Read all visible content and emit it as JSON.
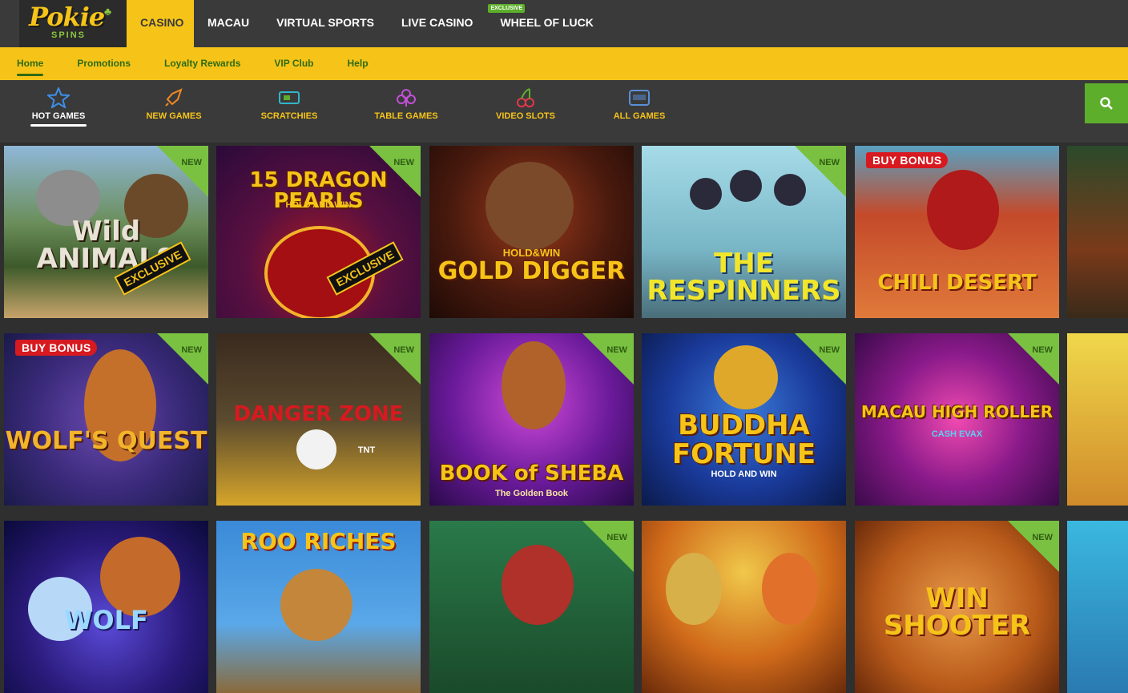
{
  "brand": {
    "name": "Pokie",
    "sub": "SPINS"
  },
  "top_nav": [
    {
      "label": "CASINO",
      "active": true
    },
    {
      "label": "MACAU"
    },
    {
      "label": "VIRTUAL SPORTS"
    },
    {
      "label": "LIVE CASINO"
    },
    {
      "label": "WHEEL OF LUCK",
      "badge": "EXCLUSIVE"
    }
  ],
  "sub_nav": [
    "Home",
    "Promotions",
    "Loyalty Rewards",
    "VIP Club",
    "Help"
  ],
  "categories": [
    {
      "label": "HOT GAMES",
      "icon": "star-icon",
      "active": true
    },
    {
      "label": "NEW GAMES",
      "icon": "rocket-icon"
    },
    {
      "label": "SCRATCHIES",
      "icon": "ticket-icon"
    },
    {
      "label": "TABLE GAMES",
      "icon": "club-icon"
    },
    {
      "label": "VIDEO SLOTS",
      "icon": "cherry-icon"
    },
    {
      "label": "ALL GAMES",
      "icon": "slot-machine-icon"
    }
  ],
  "badges": {
    "new": "NEW",
    "buy_bonus": "BUY BONUS",
    "exclusive": "EXCLUSIVE"
  },
  "games": [
    {
      "row": 0,
      "title": "Wild ANIMALS",
      "new": true,
      "exclusive": true
    },
    {
      "row": 0,
      "title": "15 DRAGON PEARLS",
      "sub": "HOLD AND WIN",
      "new": true,
      "exclusive": true
    },
    {
      "row": 0,
      "title": "GOLD DIGGER",
      "sub": "HOLD&WIN"
    },
    {
      "row": 0,
      "title": "THE RESPINNERS",
      "new": true
    },
    {
      "row": 0,
      "title": "CHILI DESERT",
      "buy_bonus": true
    },
    {
      "row": 1,
      "title": "WOLF'S QUEST",
      "new": true,
      "buy_bonus": true
    },
    {
      "row": 1,
      "title": "DANGER ZONE",
      "sub": "TNT",
      "new": true
    },
    {
      "row": 1,
      "title": "BOOK of SHEBA",
      "sub": "The Golden Book",
      "new": true
    },
    {
      "row": 1,
      "title": "BUDDHA FORTUNE",
      "sub": "HOLD AND WIN",
      "new": true
    },
    {
      "row": 1,
      "title": "MACAU HIGH ROLLER",
      "sub": "CASH EVAX",
      "new": true
    },
    {
      "row": 2,
      "title": "WOLF"
    },
    {
      "row": 2,
      "title": "ROO RICHES"
    },
    {
      "row": 2,
      "title": "",
      "new": true
    },
    {
      "row": 2,
      "title": ""
    },
    {
      "row": 2,
      "title": "WIN SHOOTER",
      "new": true
    }
  ]
}
